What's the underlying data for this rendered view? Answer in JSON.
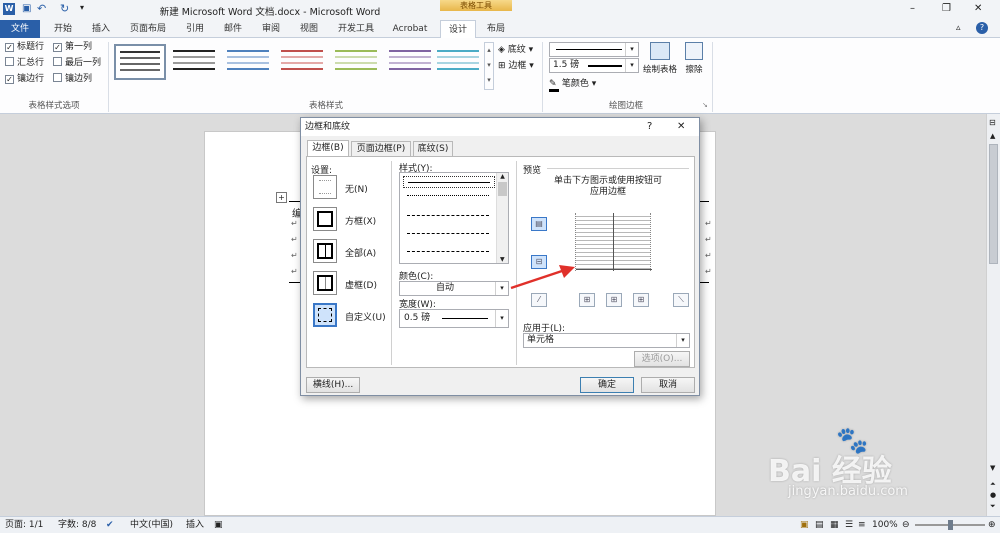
{
  "window": {
    "title": "新建 Microsoft Word 文档.docx - Microsoft Word",
    "context_tools": "表格工具",
    "controls": [
      "–",
      "❐",
      "✕"
    ]
  },
  "tabs": [
    "文件",
    "开始",
    "插入",
    "页面布局",
    "引用",
    "邮件",
    "审阅",
    "视图",
    "开发工具",
    "Acrobat",
    "设计",
    "布局"
  ],
  "ribbon": {
    "style_options": {
      "checkboxes": [
        {
          "label": "标题行",
          "checked": true
        },
        {
          "label": "第一列",
          "checked": true
        },
        {
          "label": "汇总行",
          "checked": false
        },
        {
          "label": "最后一列",
          "checked": false
        },
        {
          "label": "镶边行",
          "checked": true
        },
        {
          "label": "镶边列",
          "checked": false
        }
      ],
      "group_name": "表格样式选项"
    },
    "table_styles": {
      "group_name": "表格样式",
      "shading": "底纹",
      "borders": "边框"
    },
    "draw_borders": {
      "pen_weight": "1.5 磅",
      "pen_color": "笔颜色",
      "draw_table": "绘制表格",
      "eraser": "擦除",
      "group_name": "绘图边框"
    }
  },
  "dialog": {
    "title": "边框和底纹",
    "help": "?",
    "close": "✕",
    "tabs": [
      "边框(B)",
      "页面边框(P)",
      "底纹(S)"
    ],
    "settings": {
      "label": "设置:",
      "items": [
        "无(N)",
        "方框(X)",
        "全部(A)",
        "虚框(D)",
        "自定义(U)"
      ]
    },
    "style_label": "样式(Y):",
    "color_label": "颜色(C):",
    "color_value": "自动",
    "width_label": "宽度(W):",
    "width_value": "0.5 磅",
    "preview": {
      "label": "预览",
      "hint_line1": "单击下方图示或使用按钮可",
      "hint_line2": "应用边框"
    },
    "apply_to_label": "应用于(L):",
    "apply_to_value": "单元格",
    "options_button": "选项(O)...",
    "horizontal_line_button": "横线(H)...",
    "ok_button": "确定",
    "cancel_button": "取消"
  },
  "document": {
    "first_char": "编"
  },
  "status": {
    "page": "页面: 1/1",
    "words": "字数: 8/8",
    "language": "中文(中国)",
    "insert_mode": "插入",
    "zoom": "100%",
    "zoom_fraction": 0.5
  },
  "watermark": {
    "brand": "Bai 经验",
    "url": "jingyan.baidu.com"
  },
  "colors": {
    "file_tab": "#2a5fa8",
    "arrow": "#e0302a",
    "accent": "#3a78c8"
  }
}
